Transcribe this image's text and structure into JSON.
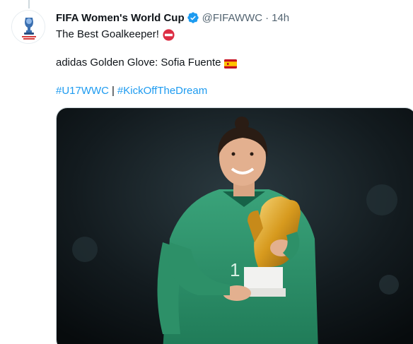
{
  "tweet": {
    "author_name": "FIFA Women's World Cup",
    "handle": "@FIFAWWC",
    "separator": "·",
    "time": "14h",
    "text_line1": "The Best Goalkeeper!",
    "text_line2": "adidas Golden Glove: Sofia Fuente",
    "hashtags": [
      "#U17WWC",
      "#KickOffTheDream"
    ],
    "hashtag_separator": "|"
  },
  "icons": {
    "verified": "verified-badge-icon",
    "emoji_1": "no-entry-emoji",
    "emoji_2": "spain-flag-emoji"
  },
  "colors": {
    "text": "#0f1419",
    "muted": "#536471",
    "link": "#1d9bf0",
    "verified": "#1d9bf0"
  },
  "media": {
    "description_icon": "goalkeeper-photo-image"
  }
}
